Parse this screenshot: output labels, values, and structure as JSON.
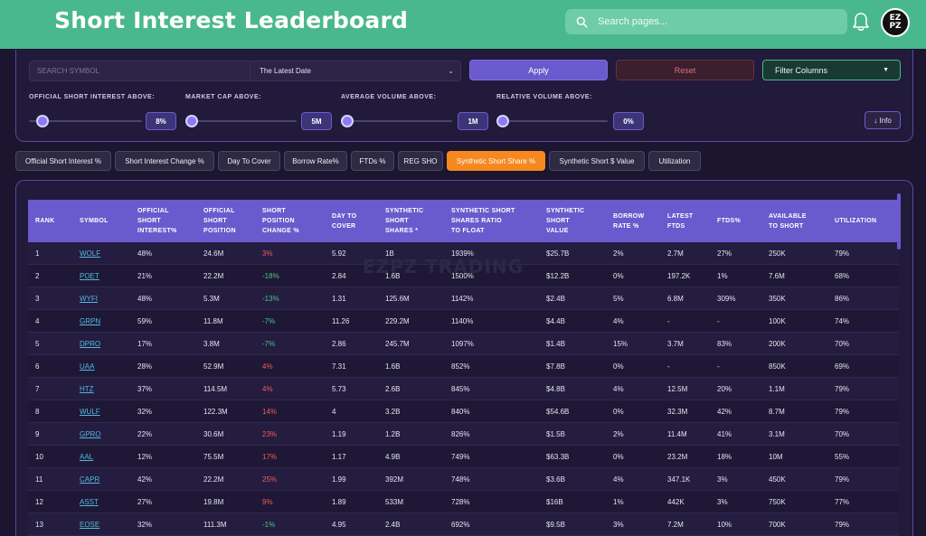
{
  "header": {
    "title": "Short Interest Leaderboard",
    "search_placeholder": "Search pages...",
    "avatar_text_top": "EZ",
    "avatar_text_bottom": "PZ"
  },
  "filters": {
    "symbol_placeholder": "SEARCH SYMBOL",
    "date_value": "The Latest Date",
    "apply_label": "Apply",
    "reset_label": "Reset",
    "filter_columns_label": "Filter Columns",
    "info_label": "↓ Info",
    "sliders": [
      {
        "label": "OFFICIAL SHORT INTEREST ABOVE:",
        "value": "8%",
        "level": 0.05
      },
      {
        "label": "MARKET CAP ABOVE:",
        "value": "5M",
        "level": 0.0
      },
      {
        "label": "AVERAGE VOLUME ABOVE:",
        "value": "1M",
        "level": 0.0
      },
      {
        "label": "RELATIVE VOLUME ABOVE:",
        "value": "0%",
        "level": 0.0
      }
    ]
  },
  "tabs": [
    {
      "label": "Official Short Interest %",
      "active": false
    },
    {
      "label": "Short Interest Change %",
      "active": false
    },
    {
      "label": "Day To Cover",
      "active": false
    },
    {
      "label": "Borrow Rate%",
      "active": false
    },
    {
      "label": "FTDs %",
      "active": false
    },
    {
      "label": "REG SHO",
      "active": false
    },
    {
      "label": "Synthetic Short Share %",
      "active": true
    },
    {
      "label": "Synthetic Short $ Value",
      "active": false
    },
    {
      "label": "Utilization",
      "active": false
    }
  ],
  "table": {
    "watermark": "EZPZ TRADING",
    "columns": [
      [
        "RANK"
      ],
      [
        "SYMBOL"
      ],
      [
        "OFFICIAL",
        "SHORT",
        "INTEREST%"
      ],
      [
        "OFFICIAL",
        "SHORT",
        "POSITION"
      ],
      [
        "SHORT",
        "POSITION",
        "CHANGE %"
      ],
      [
        "DAY TO",
        "COVER"
      ],
      [
        "SYNTHETIC",
        "SHORT",
        "SHARES *"
      ],
      [
        "SYNTHETIC SHORT",
        "SHARES RATIO",
        "TO FLOAT"
      ],
      [
        "SYNTHETIC",
        "SHORT",
        "VALUE"
      ],
      [
        "BORROW",
        "RATE %"
      ],
      [
        "LATEST",
        "FTDS"
      ],
      [
        "FTDS%"
      ],
      [
        "AVAILABLE",
        "TO SHORT"
      ],
      [
        "UTILIZATION"
      ]
    ],
    "rows": [
      [
        "1",
        "WOLF",
        "48%",
        "24.6M",
        "3%",
        "5.92",
        "1B",
        "1939%",
        "$25.7B",
        "2%",
        "2.7M",
        "27%",
        "250K",
        "79%"
      ],
      [
        "2",
        "POET",
        "21%",
        "22.2M",
        "-18%",
        "2.84",
        "1.6B",
        "1500%",
        "$12.2B",
        "0%",
        "197.2K",
        "1%",
        "7.6M",
        "68%"
      ],
      [
        "3",
        "WYFI",
        "48%",
        "5.3M",
        "-13%",
        "1.31",
        "125.6M",
        "1142%",
        "$2.4B",
        "5%",
        "6.8M",
        "309%",
        "350K",
        "86%"
      ],
      [
        "4",
        "GRPN",
        "59%",
        "11.8M",
        "-7%",
        "11.26",
        "229.2M",
        "1140%",
        "$4.4B",
        "4%",
        "-",
        "-",
        "100K",
        "74%"
      ],
      [
        "5",
        "DPRO",
        "17%",
        "3.8M",
        "-7%",
        "2.86",
        "245.7M",
        "1097%",
        "$1.4B",
        "15%",
        "3.7M",
        "83%",
        "200K",
        "70%"
      ],
      [
        "6",
        "UAA",
        "28%",
        "52.9M",
        "4%",
        "7.31",
        "1.6B",
        "852%",
        "$7.8B",
        "0%",
        "-",
        "-",
        "850K",
        "69%"
      ],
      [
        "7",
        "HTZ",
        "37%",
        "114.5M",
        "4%",
        "5.73",
        "2.6B",
        "845%",
        "$4.8B",
        "4%",
        "12.5M",
        "20%",
        "1.1M",
        "79%"
      ],
      [
        "8",
        "WULF",
        "32%",
        "122.3M",
        "14%",
        "4",
        "3.2B",
        "840%",
        "$54.6B",
        "0%",
        "32.3M",
        "42%",
        "8.7M",
        "79%"
      ],
      [
        "9",
        "GPRO",
        "22%",
        "30.6M",
        "23%",
        "1.19",
        "1.2B",
        "826%",
        "$1.5B",
        "2%",
        "11.4M",
        "41%",
        "3.1M",
        "70%"
      ],
      [
        "10",
        "AAL",
        "12%",
        "75.5M",
        "17%",
        "1.17",
        "4.9B",
        "749%",
        "$63.3B",
        "0%",
        "23.2M",
        "18%",
        "10M",
        "55%"
      ],
      [
        "11",
        "CAPR",
        "42%",
        "22.2M",
        "25%",
        "1.99",
        "392M",
        "748%",
        "$3.6B",
        "4%",
        "347.1K",
        "3%",
        "450K",
        "79%"
      ],
      [
        "12",
        "ASST",
        "27%",
        "19.8M",
        "9%",
        "1.89",
        "533M",
        "728%",
        "$16B",
        "1%",
        "442K",
        "3%",
        "750K",
        "77%"
      ],
      [
        "13",
        "EOSE",
        "32%",
        "111.3M",
        "-1%",
        "4.95",
        "2.4B",
        "692%",
        "$9.5B",
        "3%",
        "7.2M",
        "10%",
        "700K",
        "79%"
      ]
    ]
  },
  "colors": {
    "header_green": "#4ab88e",
    "accent_purple": "#6a5acd",
    "active_tab_orange": "#f5881f",
    "negative_red": "#ef5b5b",
    "positive_green": "#4cc38a",
    "symbol_link_blue": "#54b7dc"
  }
}
